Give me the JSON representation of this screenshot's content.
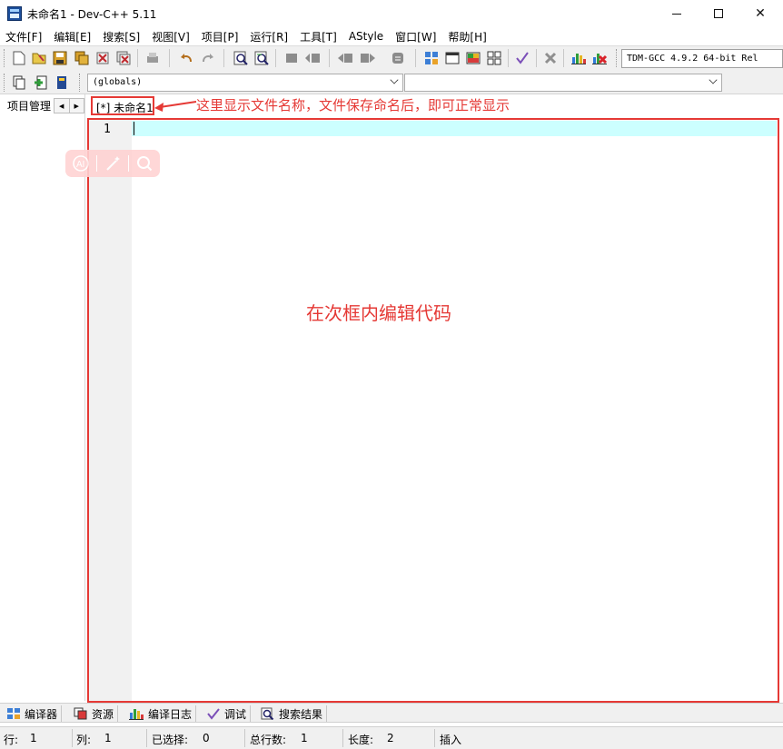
{
  "window": {
    "title": "未命名1 - Dev-C++ 5.11"
  },
  "menu": {
    "items": [
      "文件[F]",
      "编辑[E]",
      "搜索[S]",
      "视图[V]",
      "项目[P]",
      "运行[R]",
      "工具[T]",
      "AStyle",
      "窗口[W]",
      "帮助[H]"
    ]
  },
  "toolbar": {
    "compiler": "TDM-GCC 4.9.2 64-bit Rel",
    "scope_combo": "(globals)",
    "symbol_combo": ""
  },
  "left_panel": {
    "tab_label": "项目管理"
  },
  "editor": {
    "tab_label": "[*] 未命名1",
    "line_numbers": [
      "1"
    ]
  },
  "annotations": {
    "tab_note": "这里显示文件名称，文件保存命名后，即可正常显示",
    "editor_note": "在次框内编辑代码"
  },
  "bottom_tabs": {
    "items": [
      "编译器",
      "资源",
      "编译日志",
      "调试",
      "搜索结果"
    ]
  },
  "status": {
    "row_label": "行:",
    "row_value": "1",
    "col_label": "列:",
    "col_value": "1",
    "sel_label": "已选择:",
    "sel_value": "0",
    "total_label": "总行数:",
    "total_value": "1",
    "len_label": "长度:",
    "len_value": "2",
    "mode": "插入"
  },
  "colors": {
    "annotation": "#e53935",
    "current_line": "#ccffff"
  },
  "icons": {
    "ai_toolbar": [
      "ai-icon",
      "magic-wand-icon",
      "search-icon"
    ]
  }
}
